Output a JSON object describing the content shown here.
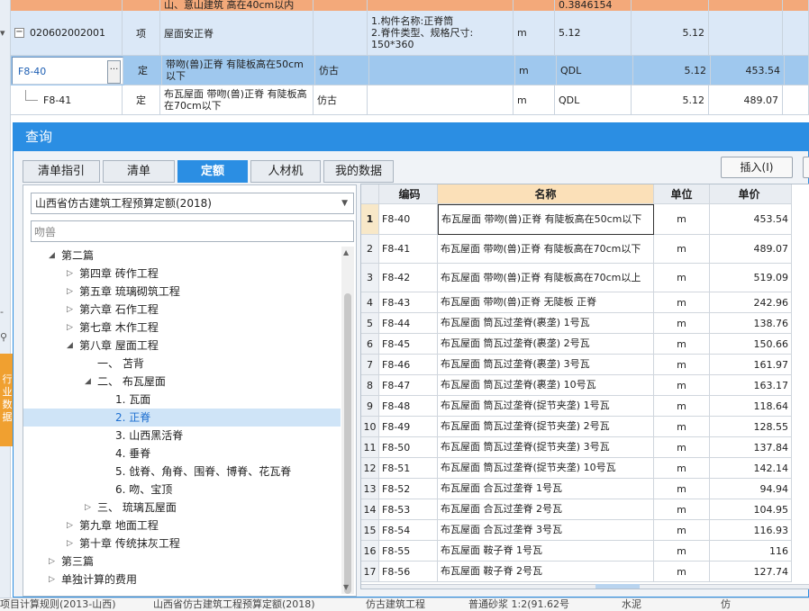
{
  "background": {
    "top_partial_name": "山、意山建筑 高在40cm以内",
    "top_partial_qty": "0.3846154",
    "item_row": {
      "code": "020602002001",
      "type": "项",
      "name": "屋面安正脊",
      "feature_1": "1.构件名称:正脊筒",
      "feature_2": "2.脊件类型、规格尺寸:",
      "feature_3": "150*360",
      "unit": "m",
      "expr": "5.12",
      "qty": "5.12"
    },
    "selected_row": {
      "code": "F8-40",
      "type": "定",
      "name": "带吻(兽)正脊 有陡板高在50cm以下",
      "spec": "仿古",
      "unit": "m",
      "expr": "QDL",
      "qty": "5.12",
      "price": "453.54"
    },
    "sub_row": {
      "code": "F8-41",
      "type": "定",
      "name": "布瓦屋面 带吻(兽)正脊 有陡板高在70cm以下",
      "spec": "仿古",
      "unit": "m",
      "expr": "QDL",
      "qty": "5.12",
      "price": "489.07"
    },
    "bottom_strip": [
      "项目计算规则(2013-山西)",
      "山西省仿古建筑工程预算定额(2018)",
      "仿古建筑工程",
      "普通砂浆 1:2(91.62号",
      "水泥",
      "仿"
    ],
    "left_side_text": "行业数据"
  },
  "dialog": {
    "title": "查询",
    "tabs": [
      "清单指引",
      "清单",
      "定额",
      "人材机",
      "我的数据"
    ],
    "active_tab": "定额",
    "insert_button": "插入(I)",
    "quota_library": "山西省仿古建筑工程预算定额(2018)",
    "search_value": "吻兽",
    "tree": [
      "第二篇",
      "第四章 砖作工程",
      "第五章 琉璃砌筑工程",
      "第六章 石作工程",
      "第七章 木作工程",
      "第八章 屋面工程",
      "一、 苫背",
      "二、 布瓦屋面",
      "1. 瓦面",
      "2. 正脊",
      "3. 山西黑活脊",
      "4. 垂脊",
      "5. 戗脊、角脊、围脊、博脊、花瓦脊",
      "6. 吻、宝顶",
      "三、 琉璃瓦屋面",
      "第九章 地面工程",
      "第十章 传统抹灰工程",
      "第三篇",
      "单独计算的费用"
    ],
    "grid": {
      "headers": [
        "编码",
        "名称",
        "单位",
        "单价"
      ],
      "rows": [
        [
          "1",
          "F8-40",
          "布瓦屋面 带吻(兽)正脊 有陡板高在50cm以下",
          "m",
          "453.54"
        ],
        [
          "2",
          "F8-41",
          "布瓦屋面 带吻(兽)正脊 有陡板高在70cm以下",
          "m",
          "489.07"
        ],
        [
          "3",
          "F8-42",
          "布瓦屋面 带吻(兽)正脊 有陡板高在70cm以上",
          "m",
          "519.09"
        ],
        [
          "4",
          "F8-43",
          "布瓦屋面 带吻(兽)正脊 无陡板 正脊",
          "m",
          "242.96"
        ],
        [
          "5",
          "F8-44",
          "布瓦屋面 筒瓦过垄脊(裹垄) 1号瓦",
          "m",
          "138.76"
        ],
        [
          "6",
          "F8-45",
          "布瓦屋面 筒瓦过垄脊(裹垄) 2号瓦",
          "m",
          "150.66"
        ],
        [
          "7",
          "F8-46",
          "布瓦屋面 筒瓦过垄脊(裹垄) 3号瓦",
          "m",
          "161.97"
        ],
        [
          "8",
          "F8-47",
          "布瓦屋面 筒瓦过垄脊(裹垄) 10号瓦",
          "m",
          "163.17"
        ],
        [
          "9",
          "F8-48",
          "布瓦屋面 筒瓦过垄脊(捉节夹垄) 1号瓦",
          "m",
          "118.64"
        ],
        [
          "10",
          "F8-49",
          "布瓦屋面 筒瓦过垄脊(捉节夹垄) 2号瓦",
          "m",
          "128.55"
        ],
        [
          "11",
          "F8-50",
          "布瓦屋面 筒瓦过垄脊(捉节夹垄) 3号瓦",
          "m",
          "137.84"
        ],
        [
          "12",
          "F8-51",
          "布瓦屋面 筒瓦过垄脊(捉节夹垄) 10号瓦",
          "m",
          "142.14"
        ],
        [
          "13",
          "F8-52",
          "布瓦屋面 合瓦过垄脊 1号瓦",
          "m",
          "94.94"
        ],
        [
          "14",
          "F8-53",
          "布瓦屋面 合瓦过垄脊 2号瓦",
          "m",
          "104.95"
        ],
        [
          "15",
          "F8-54",
          "布瓦屋面 合瓦过垄脊 3号瓦",
          "m",
          "116.93"
        ],
        [
          "16",
          "F8-55",
          "布瓦屋面 鞍子脊 1号瓦",
          "m",
          "116"
        ],
        [
          "17",
          "F8-56",
          "布瓦屋面 鞍子脊 2号瓦",
          "m",
          "127.74"
        ]
      ]
    }
  }
}
